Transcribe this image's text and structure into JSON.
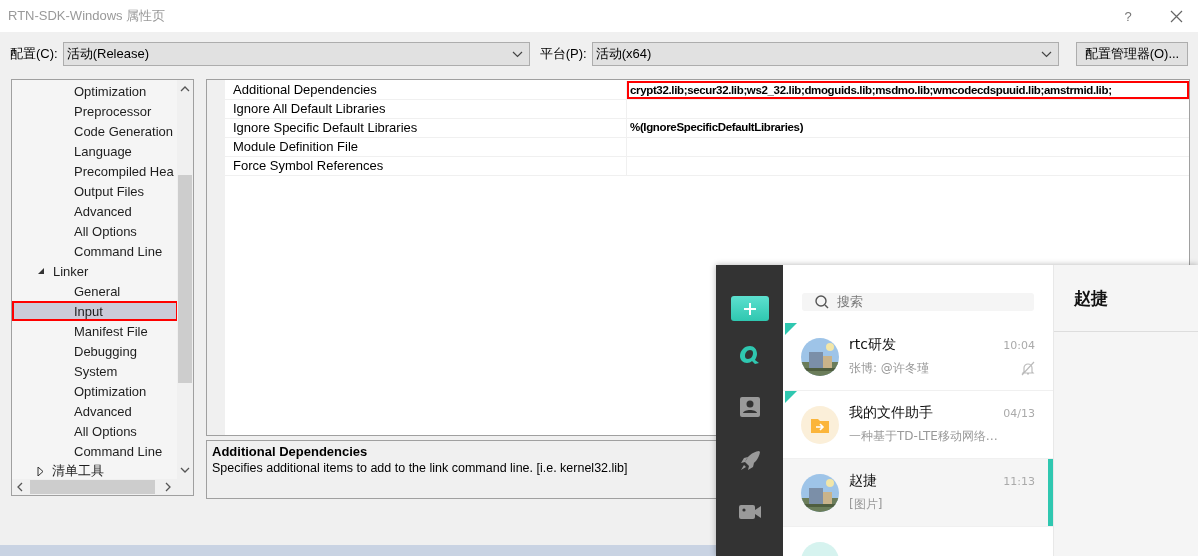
{
  "window": {
    "title": "RTN-SDK-Windows 属性页",
    "help": "?"
  },
  "toolbar": {
    "configuration_label": "配置(C):",
    "configuration": "活动(Release)",
    "platform_label": "平台(P):",
    "platform": "活动(x64)",
    "manager_button": "配置管理器(O)..."
  },
  "tree": {
    "items": [
      {
        "children": [
          {
            "label": "Optimization",
            "selected": false
          },
          {
            "label": "Preprocessor",
            "selected": false
          },
          {
            "label": "Code Generation",
            "selected": false
          },
          {
            "label": "Language",
            "selected": false
          },
          {
            "label": "Precompiled Hea",
            "selected": false
          },
          {
            "label": "Output Files",
            "selected": false
          },
          {
            "label": "Advanced",
            "selected": false
          },
          {
            "label": "All Options",
            "selected": false
          },
          {
            "label": "Command Line",
            "selected": false
          }
        ]
      },
      {
        "label": "Linker",
        "expanded": true,
        "selected": false,
        "children": [
          {
            "label": "General",
            "selected": false
          },
          {
            "label": "Input",
            "selected": true
          },
          {
            "label": "Manifest File",
            "selected": false
          },
          {
            "label": "Debugging",
            "selected": false
          },
          {
            "label": "System",
            "selected": false
          },
          {
            "label": "Optimization",
            "selected": false
          },
          {
            "label": "Advanced",
            "selected": false
          },
          {
            "label": "All Options",
            "selected": false
          },
          {
            "label": "Command Line",
            "selected": false
          }
        ]
      },
      {
        "label": "清单工具",
        "expanded": false,
        "selected": false
      }
    ]
  },
  "properties": [
    {
      "name": "Additional Dependencies",
      "value": "crypt32.lib;secur32.lib;ws2_32.lib;dmoguids.lib;msdmo.lib;wmcodecdspuuid.lib;amstrmid.lib;",
      "highlighted": true
    },
    {
      "name": "Ignore All Default Libraries",
      "highlighted": false
    },
    {
      "name": "Ignore Specific Default Libraries",
      "value": "%(IgnoreSpecificDefaultLibraries)",
      "highlighted": false
    },
    {
      "name": "Module Definition File",
      "highlighted": false
    },
    {
      "name": "Force Symbol References",
      "highlighted": false
    }
  ],
  "description": {
    "title": "Additional Dependencies",
    "text": "Specifies additional items to add to the link command line. [i.e. kernel32.lib]"
  },
  "chat": {
    "nav": [
      {
        "kind": "add",
        "selected": false
      },
      {
        "kind": "chats",
        "selected": true
      },
      {
        "kind": "contacts",
        "selected": false
      },
      {
        "kind": "rocket",
        "selected": false
      },
      {
        "kind": "video",
        "selected": false
      }
    ],
    "search": {
      "placeholder": "搜索"
    },
    "conversations": [
      {
        "name": "rtc研发",
        "preview": "张博: @许冬瑾",
        "time": "10:04",
        "kind": "picture",
        "pinned": true,
        "muted": true,
        "selected": false
      },
      {
        "name": "我的文件助手",
        "preview": "一种基于TD-LTE移动网络…",
        "time": "04/13",
        "kind": "file",
        "pinned": true,
        "muted": false,
        "selected": false
      },
      {
        "name": "赵捷",
        "preview": "[图片]",
        "time": "11:13",
        "kind": "picture",
        "pinned": false,
        "muted": false,
        "selected": true
      },
      {
        "kind": "plain",
        "pinned": false,
        "muted": false,
        "selected": false
      }
    ],
    "header": "赵捷"
  }
}
